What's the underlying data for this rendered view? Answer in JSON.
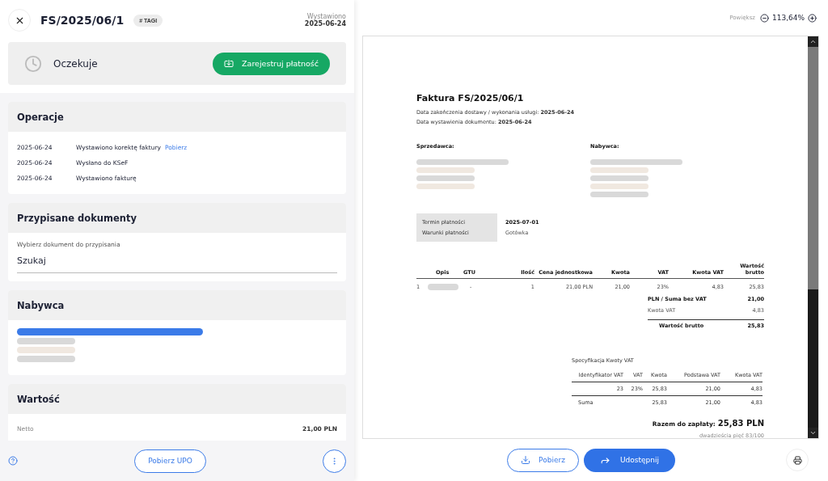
{
  "header": {
    "number": "FS/2025/06/1",
    "tag": "# TAGI",
    "issued_label": "Wystawiono",
    "issued_date": "2025-06-24"
  },
  "status": {
    "label": "Oczekuje",
    "action": "Zarejestruj płatność"
  },
  "operations": {
    "title": "Operacje",
    "rows": [
      {
        "date": "2025-06-24",
        "text": "Wystawiono korektę faktury",
        "link": "Pobierz"
      },
      {
        "date": "2025-06-24",
        "text": "Wysłano do KSeF"
      },
      {
        "date": "2025-06-24",
        "text": "Wystawiono fakturę"
      }
    ]
  },
  "assigned": {
    "title": "Przypisane dokumenty",
    "field_label": "Wybierz dokument do przypisania",
    "placeholder": "Szukaj"
  },
  "buyer": {
    "title": "Nabywca",
    "redacted": [
      {
        "kind": "wide",
        "color": "#3b7be8"
      },
      {
        "kind": "short",
        "color": "#d9d9d9"
      },
      {
        "kind": "short",
        "color": "#f0e8e0"
      },
      {
        "kind": "short",
        "color": "#d9d9d9"
      }
    ]
  },
  "value": {
    "title": "Wartość",
    "rows": [
      {
        "label": "Netto",
        "amount": "21,00 PLN"
      }
    ]
  },
  "footer": {
    "upload": "Pobierz UPO"
  },
  "preview": {
    "zoom_label": "Powiększ",
    "zoom": "113,64%"
  },
  "document": {
    "title": "Faktura FS/2025/06/1",
    "dates": [
      "Data zakończenia dostawy / wykonania usługi: **2025-06-24**",
      "Data wystawienia dokumentu: **2025-06-24**"
    ],
    "parties": [
      {
        "heading": "Sprzedawca:",
        "redacted": [
          {
            "kind": "wide",
            "color": "#d9d9d9"
          },
          {
            "kind": "short",
            "color": "#f0e8e0"
          },
          {
            "kind": "short",
            "color": "#d9d9d9"
          },
          {
            "kind": "short",
            "color": "#f0e8e0"
          }
        ]
      },
      {
        "heading": "Nabywca:",
        "redacted": [
          {
            "kind": "wide",
            "color": "#d9d9d9"
          },
          {
            "kind": "short",
            "color": "#f0e8e0"
          },
          {
            "kind": "short",
            "color": "#d9d9d9"
          },
          {
            "kind": "short",
            "color": "#f0e8e0"
          },
          {
            "kind": "short",
            "color": "#d9d9d9"
          }
        ]
      }
    ],
    "payment": [
      {
        "label": "Termin płatności",
        "value": "2025-07-01",
        "emphasis": true
      },
      {
        "label": "Warunki płatności",
        "value": "Gotówka",
        "emphasis": false
      }
    ],
    "items": {
      "columns": [
        "Opis",
        "GTU",
        "Ilość",
        "Cena jednostkowa",
        "Kwota",
        "VAT",
        "Kwota VAT",
        "Wartość brutto"
      ],
      "rows": [
        {
          "number": "1",
          "gtu": "-",
          "qty": "1",
          "unit_price": "21,00 PLN",
          "amount": "21,00",
          "vat": "23%",
          "vat_amount": "4,83",
          "gross": "25,83"
        }
      ]
    },
    "totals": [
      {
        "label": "PLN / Suma bez VAT",
        "value": "21,00",
        "emphasis": true
      },
      {
        "label": "Kwota VAT",
        "value": "4,83",
        "emphasis": false
      },
      {
        "label": "Wartość brutto",
        "value": "25,83",
        "emphasis": true
      }
    ],
    "vat_spec": {
      "title": "Specyfikacja Kwoty VAT",
      "columns": [
        "Identyfikator VAT",
        "VAT",
        "Kwota",
        "Podstawa VAT",
        "Kwota VAT"
      ],
      "rows": [
        [
          "23",
          "23%",
          "25,83",
          "21,00",
          "4,83"
        ]
      ],
      "sum": {
        "label": "Suma",
        "values": [
          "25,83",
          "21,00",
          "4,83"
        ]
      }
    },
    "due": {
      "label": "Razem do zapłaty:",
      "amount": "25,83 PLN",
      "words": "dwadzieścia pięć 83/100"
    }
  },
  "actions": {
    "download": "Pobierz",
    "share": "Udostępnij"
  }
}
